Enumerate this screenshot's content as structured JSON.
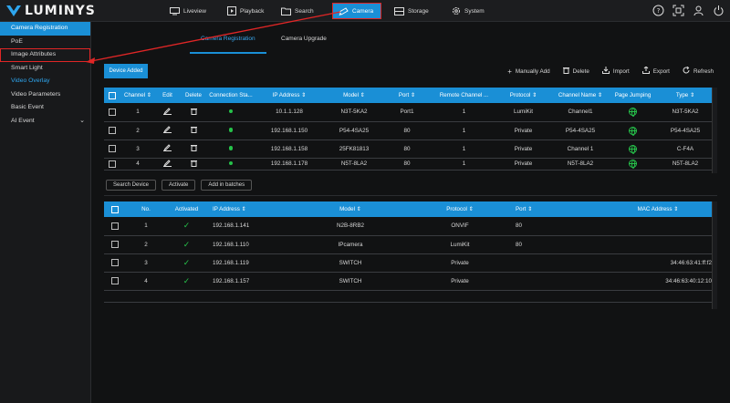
{
  "brand": {
    "name": "LUMINYS"
  },
  "nav": {
    "tabs": [
      {
        "label": "Liveview",
        "icon": "monitor-icon"
      },
      {
        "label": "Playback",
        "icon": "playback-icon"
      },
      {
        "label": "Search",
        "icon": "folder-icon"
      },
      {
        "label": "Camera",
        "icon": "camera-icon",
        "active": true
      },
      {
        "label": "Storage",
        "icon": "storage-icon"
      },
      {
        "label": "System",
        "icon": "gear-icon"
      }
    ]
  },
  "sidebar": {
    "items": [
      {
        "label": "Camera Registration",
        "state": "active"
      },
      {
        "label": "PoE"
      },
      {
        "label": "Image Attributes",
        "state": "outlined"
      },
      {
        "label": "Smart Light"
      },
      {
        "label": "Video Overlay",
        "state": "selected"
      },
      {
        "label": "Video Parameters"
      },
      {
        "label": "Basic Event"
      },
      {
        "label": "AI Event",
        "chevron": "⌄"
      }
    ]
  },
  "subtabs": [
    "Camera Registration",
    "Camera Upgrade"
  ],
  "primary_button": "Device Added",
  "toolbar": {
    "manually_add": "Manually Add",
    "delete": "Delete",
    "import": "Import",
    "export": "Export",
    "refresh": "Refresh"
  },
  "added_table": {
    "headers": [
      "Channel ⇕",
      "Edit",
      "Delete",
      "Connection Sta...",
      "IP Address ⇕",
      "Model ⇕",
      "Port ⇕",
      "Remote Channel ...",
      "Protocol ⇕",
      "Channel Name ⇕",
      "Page Jumping",
      "Type ⇕"
    ],
    "rows": [
      {
        "channel": "1",
        "ip": "10.1.1.128",
        "model": "N3T-5KA2",
        "port": "Port1",
        "remote": "1",
        "protocol": "LumiKit",
        "name": "Channel1",
        "type": "N3T-5KA2"
      },
      {
        "channel": "2",
        "ip": "192.168.1.150",
        "model": "P54-4SA25",
        "port": "80",
        "remote": "1",
        "protocol": "Private",
        "name": "P54-4SA25",
        "type": "P54-4SA25"
      },
      {
        "channel": "3",
        "ip": "192.168.1.158",
        "model": "25FK81813",
        "port": "80",
        "remote": "1",
        "protocol": "Private",
        "name": "Channel 1",
        "type": "C-F4A"
      },
      {
        "channel": "4",
        "ip": "192.168.1.178",
        "model": "N5T-8LA2",
        "port": "80",
        "remote": "1",
        "protocol": "Private",
        "name": "N5T-8LA2",
        "type": "N5T-8LA2"
      }
    ]
  },
  "action_buttons": [
    "Search Device",
    "Activate",
    "Add in batches"
  ],
  "search_table": {
    "headers": [
      "No.",
      "Activated",
      "IP Address ⇕",
      "Model ⇕",
      "Protocol ⇕",
      "Port ⇕",
      "MAC Address ⇕"
    ],
    "rows": [
      {
        "no": "1",
        "ip": "192.168.1.141",
        "model": "N2B-8RB2",
        "protocol": "ONVIF",
        "port": "80",
        "mac": ""
      },
      {
        "no": "2",
        "ip": "192.168.1.110",
        "model": "IPcamera",
        "protocol": "LumiKit",
        "port": "80",
        "mac": ""
      },
      {
        "no": "3",
        "ip": "192.168.1.119",
        "model": "SWITCH",
        "protocol": "Private",
        "port": "",
        "mac": "34:46:63:41:ff:f2"
      },
      {
        "no": "4",
        "ip": "192.168.1.157",
        "model": "SWITCH",
        "protocol": "Private",
        "port": "",
        "mac": "34:46:63:40:12:10"
      }
    ]
  },
  "colors": {
    "accent": "#1a8fd6",
    "highlight_outline": "#e02626",
    "status_green": "#26c24a"
  }
}
